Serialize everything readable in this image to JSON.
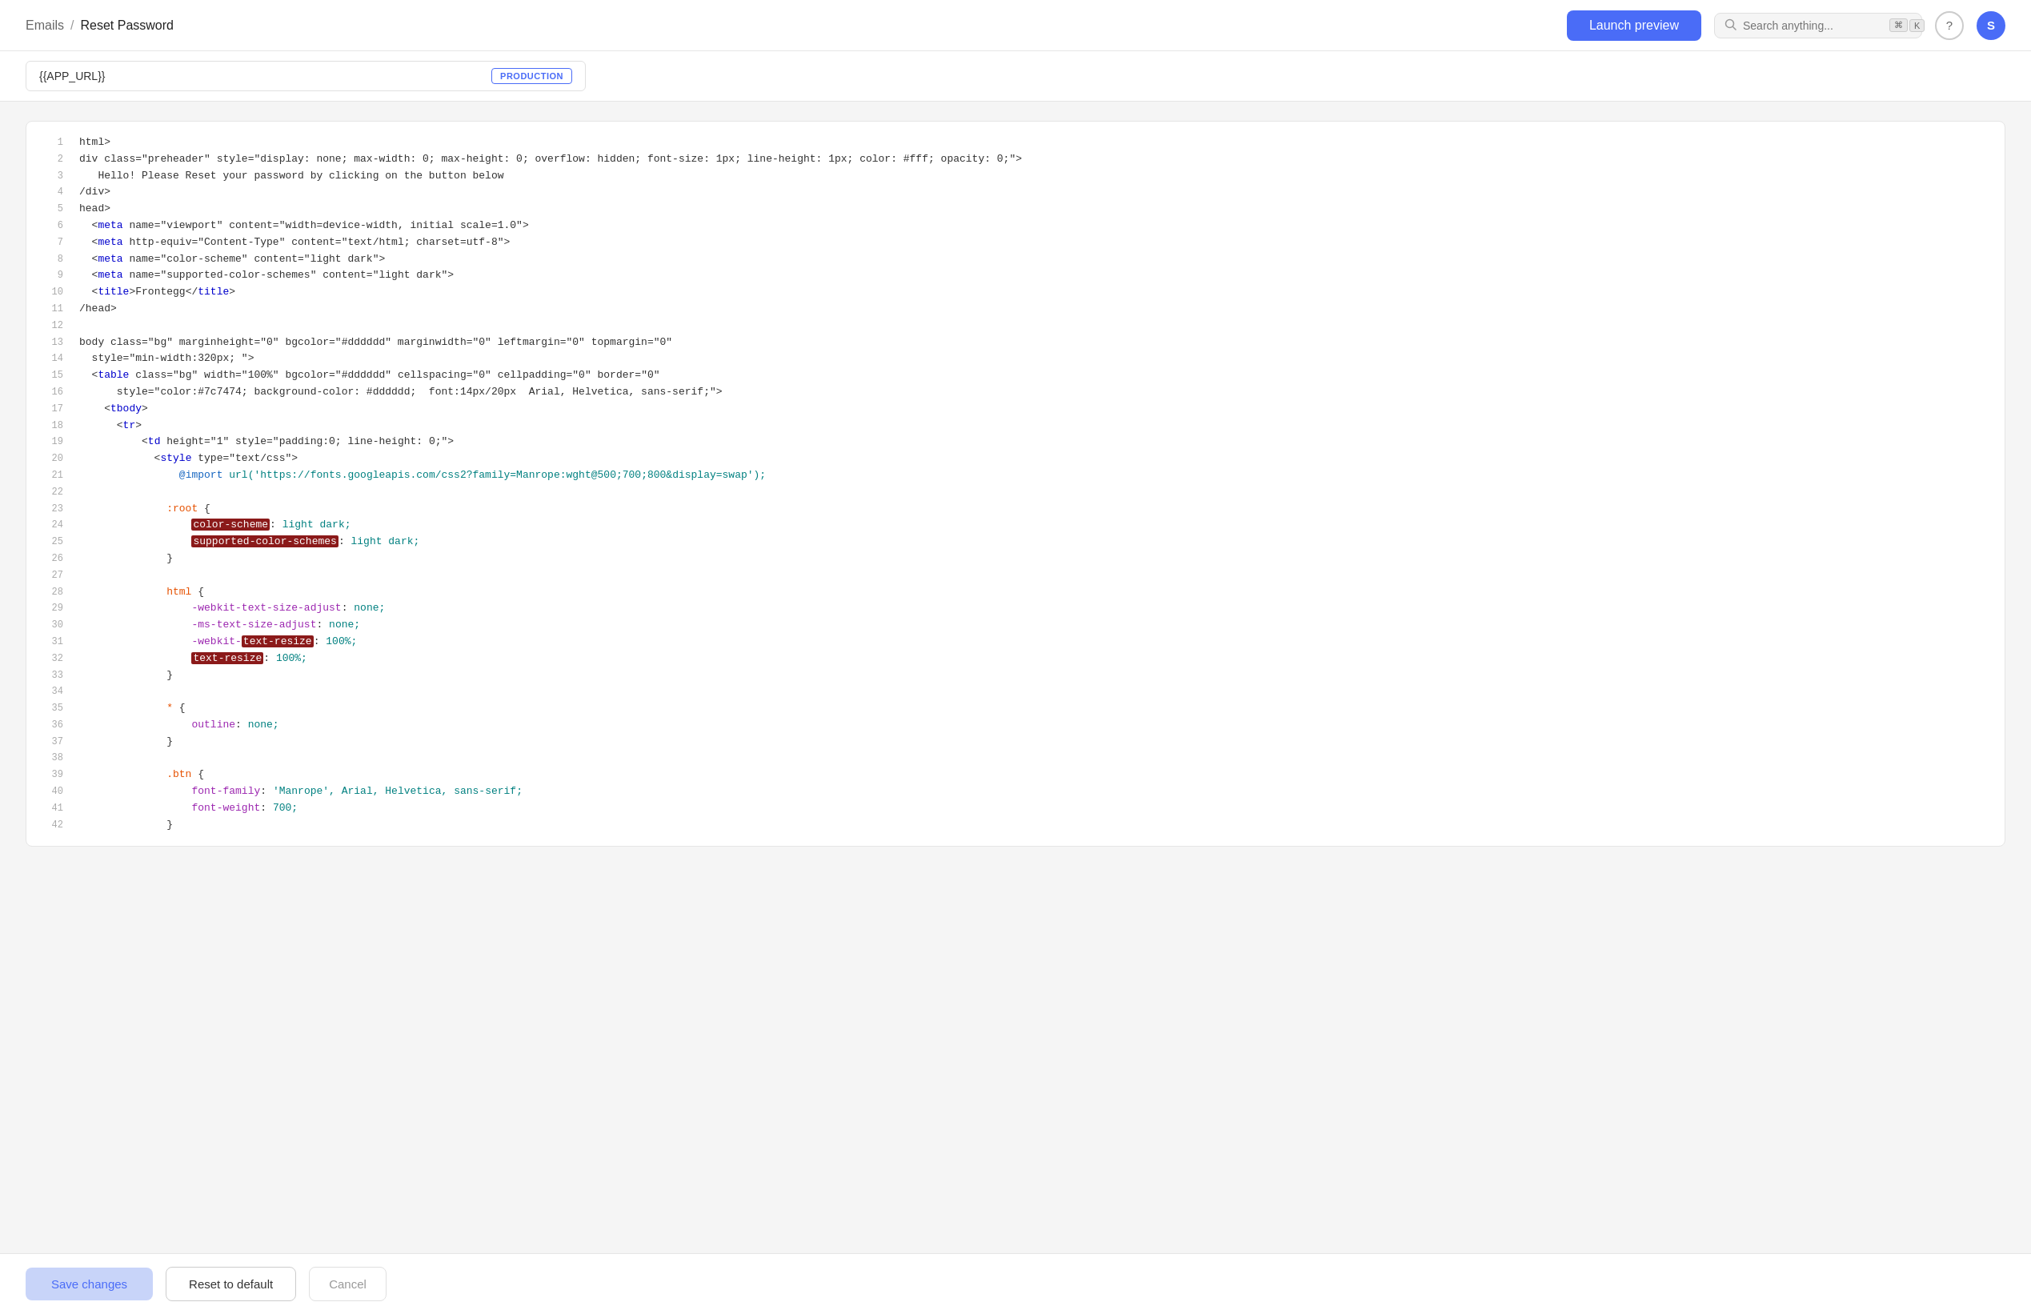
{
  "header": {
    "breadcrumb_emails": "Emails",
    "breadcrumb_sep": "/",
    "breadcrumb_page": "Reset Password",
    "launch_preview": "Launch preview",
    "search_placeholder": "Search anything...",
    "kbd1": "⌘",
    "kbd2": "K",
    "help_icon": "?",
    "avatar_label": "S"
  },
  "url_bar": {
    "url_text": "{{APP_URL}}",
    "env_badge": "PRODUCTION"
  },
  "footer": {
    "save_label": "Save changes",
    "reset_label": "Reset to default",
    "cancel_label": "Cancel"
  },
  "code_lines": [
    {
      "num": 1,
      "raw": "html>"
    },
    {
      "num": 2,
      "raw": "div class=\"preheader\" style=\"display: none; max-width: 0; max-height: 0; overflow: hidden; font-size: 1px; line-height: 1px; color: #fff; opacity: 0;\">"
    },
    {
      "num": 3,
      "raw": "   Hello! Please Reset your password by clicking on the button below"
    },
    {
      "num": 4,
      "raw": "/div>"
    },
    {
      "num": 5,
      "raw": "head>"
    },
    {
      "num": 6,
      "raw": "  <meta name=\"viewport\" content=\"width=device-width, initial scale=1.0\">"
    },
    {
      "num": 7,
      "raw": "  <meta http-equiv=\"Content-Type\" content=\"text/html; charset=utf-8\">"
    },
    {
      "num": 8,
      "raw": "  <meta name=\"color-scheme\" content=\"light dark\">"
    },
    {
      "num": 9,
      "raw": "  <meta name=\"supported-color-schemes\" content=\"light dark\">"
    },
    {
      "num": 10,
      "raw": "  <title>Frontegg</title>"
    },
    {
      "num": 11,
      "raw": "/head>"
    },
    {
      "num": 12,
      "raw": ""
    },
    {
      "num": 13,
      "raw": "body class=\"bg\" marginheight=\"0\" bgcolor=\"#dddddd\" marginwidth=\"0\" leftmargin=\"0\" topmargin=\"0\""
    },
    {
      "num": 14,
      "raw": "  style=\"min-width:320px; \">"
    },
    {
      "num": 15,
      "raw": "  <table class=\"bg\" width=\"100%\" bgcolor=\"#dddddd\" cellspacing=\"0\" cellpadding=\"0\" border=\"0\""
    },
    {
      "num": 16,
      "raw": "      style=\"color:#7c7474; background-color: #dddddd;  font:14px/20px  Arial, Helvetica, sans-serif;\">"
    },
    {
      "num": 17,
      "raw": "    <tbody>"
    },
    {
      "num": 18,
      "raw": "      <tr>"
    },
    {
      "num": 19,
      "raw": "          <td height=\"1\" style=\"padding:0; line-height: 0;\">"
    },
    {
      "num": 20,
      "raw": "            <style type=\"text/css\">"
    },
    {
      "num": 21,
      "raw": "                @import url('https://fonts.googleapis.com/css2?family=Manrope:wght@500;700;800&display=swap');"
    },
    {
      "num": 22,
      "raw": ""
    },
    {
      "num": 23,
      "raw": "              :root {"
    },
    {
      "num": 24,
      "raw": "                  color-scheme: light dark;"
    },
    {
      "num": 25,
      "raw": "                  supported-color-schemes: light dark;"
    },
    {
      "num": 26,
      "raw": "              }"
    },
    {
      "num": 27,
      "raw": ""
    },
    {
      "num": 28,
      "raw": "              html {"
    },
    {
      "num": 29,
      "raw": "                  -webkit-text-size-adjust: none;"
    },
    {
      "num": 30,
      "raw": "                  -ms-text-size-adjust: none;"
    },
    {
      "num": 31,
      "raw": "                  -webkit-text-resize: 100%;"
    },
    {
      "num": 32,
      "raw": "                  text-resize: 100%;"
    },
    {
      "num": 33,
      "raw": "              }"
    },
    {
      "num": 34,
      "raw": ""
    },
    {
      "num": 35,
      "raw": "              * {"
    },
    {
      "num": 36,
      "raw": "                  outline: none;"
    },
    {
      "num": 37,
      "raw": "              }"
    },
    {
      "num": 38,
      "raw": ""
    },
    {
      "num": 39,
      "raw": "              .btn {"
    },
    {
      "num": 40,
      "raw": "                  font-family: 'Manrope', Arial, Helvetica, sans-serif;"
    },
    {
      "num": 41,
      "raw": "                  font-weight: 700;"
    },
    {
      "num": 42,
      "raw": "              }"
    }
  ]
}
